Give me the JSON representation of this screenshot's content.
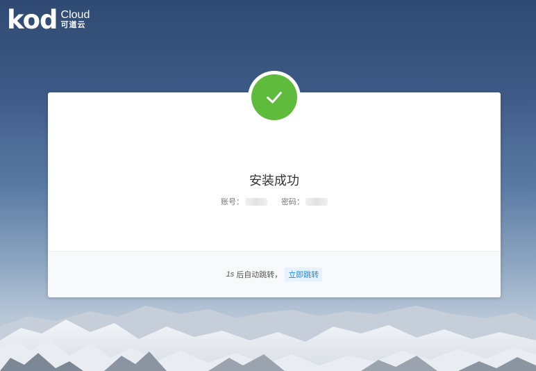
{
  "logo": {
    "mark": "kod",
    "cloud": "Cloud",
    "cn": "可道云"
  },
  "result": {
    "icon": "check-icon",
    "title": "安装成功",
    "account_label": "账号：",
    "password_label": "密码："
  },
  "footer": {
    "countdown": "1s",
    "message": "后自动跳转，",
    "jump_label": "立即跳转"
  },
  "colors": {
    "success": "#5fbb3b",
    "link": "#1e88e5",
    "link_bg": "#e6f3ff"
  }
}
